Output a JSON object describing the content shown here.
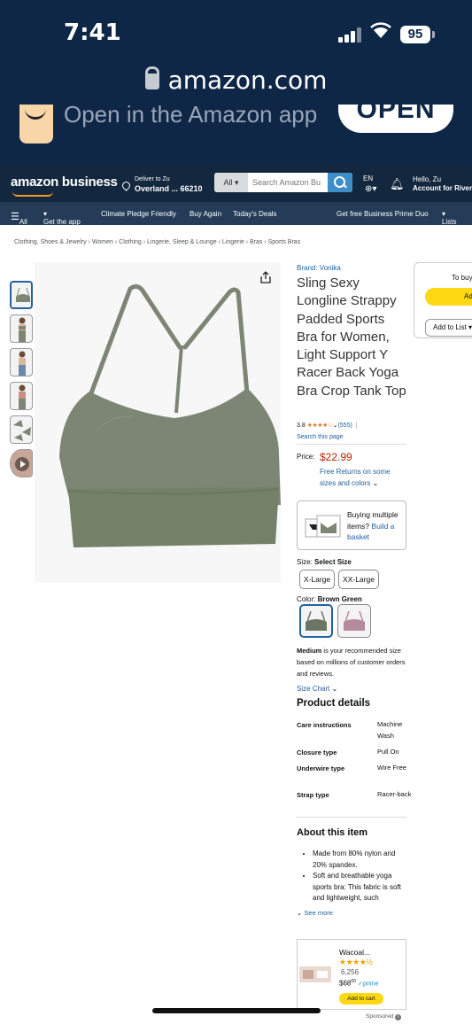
{
  "status_bar": {
    "time": "7:41",
    "battery": "95",
    "url": "amazon.com"
  },
  "app_banner": {
    "title": "Open in the Amazon app",
    "open_label": "OPEN"
  },
  "header": {
    "logo": "amazon business",
    "deliver_line1": "Deliver to Zu",
    "deliver_line2": "Overland ... 66210",
    "search_category": "All",
    "search_placeholder": "Search Amazon Bu",
    "language": "EN",
    "account_line1": "Hello, Zu",
    "account_line2": "Account for River"
  },
  "nav": {
    "all": "All",
    "items": [
      "Get the app",
      "Climate Pledge Friendly",
      "Buy Again",
      "Today's Deals",
      "Get free Business Prime Duo",
      "Lists"
    ]
  },
  "breadcrumb": "Clothing, Shoes & Jewelry › Women › Clothing › Lingerie, Sleep & Lounge › Lingerie › Bras › Sports Bras",
  "product": {
    "brand": "Brand: Vonika",
    "title": "Sling Sexy Longline Strappy Padded Sports Bra for Women, Light Support Y Racer Back Yoga Bra Crop Tank Top",
    "rating_value": "3.8",
    "rating_stars": "★★★★☆",
    "rating_fraction": 0.76,
    "review_count": "(555)",
    "search_page": "Search this page",
    "price_label": "Price:",
    "price": "$22.99",
    "returns": "Free Returns on some sizes and colors",
    "basket_text": "Buying multiple items?",
    "basket_link": "Build a basket",
    "size_label": "Size:",
    "size_value": "Select Size",
    "sizes": [
      "X-Large",
      "XX-Large"
    ],
    "color_label": "Color:",
    "color_value": "Brown Green",
    "swatch_colors": [
      "#6b7564",
      "#b58a9c"
    ],
    "reco_bold": "Medium",
    "reco_rest": " is your recommended size based on millions of customer orders and reviews.",
    "size_chart": "Size Chart",
    "details_heading": "Product details",
    "details": [
      {
        "k": "Care instructions",
        "v": "Machine Wash"
      },
      {
        "k": "Closure type",
        "v": "Pull On"
      },
      {
        "k": "Underwire type",
        "v": "Wire Free"
      },
      {
        "k": "Strap type",
        "v": "Racer-back"
      }
    ],
    "about_heading": "About this item",
    "bullets": [
      "Made from 80% nylon and 20% spandex.",
      "Soft and breathable yoga sports bra: This fabric is soft and lightweight, such"
    ],
    "see_more": "See more"
  },
  "sponsored_ad": {
    "name": "Wacoal...",
    "stars": "★★★★½",
    "count": "6,256",
    "price_dollars": "$68",
    "price_cents": "00",
    "prime": "prime",
    "cta": "Add to cart",
    "sponsored": "Sponsored"
  },
  "buy_box": {
    "line1": "To buy",
    "add_btn": "Ad",
    "add_to_list": "Add to List"
  },
  "colors": {
    "garment": "#7d8674",
    "accent": "#2162a1",
    "price": "#b12704",
    "header": "#13283f",
    "cta": "#ffd814"
  }
}
